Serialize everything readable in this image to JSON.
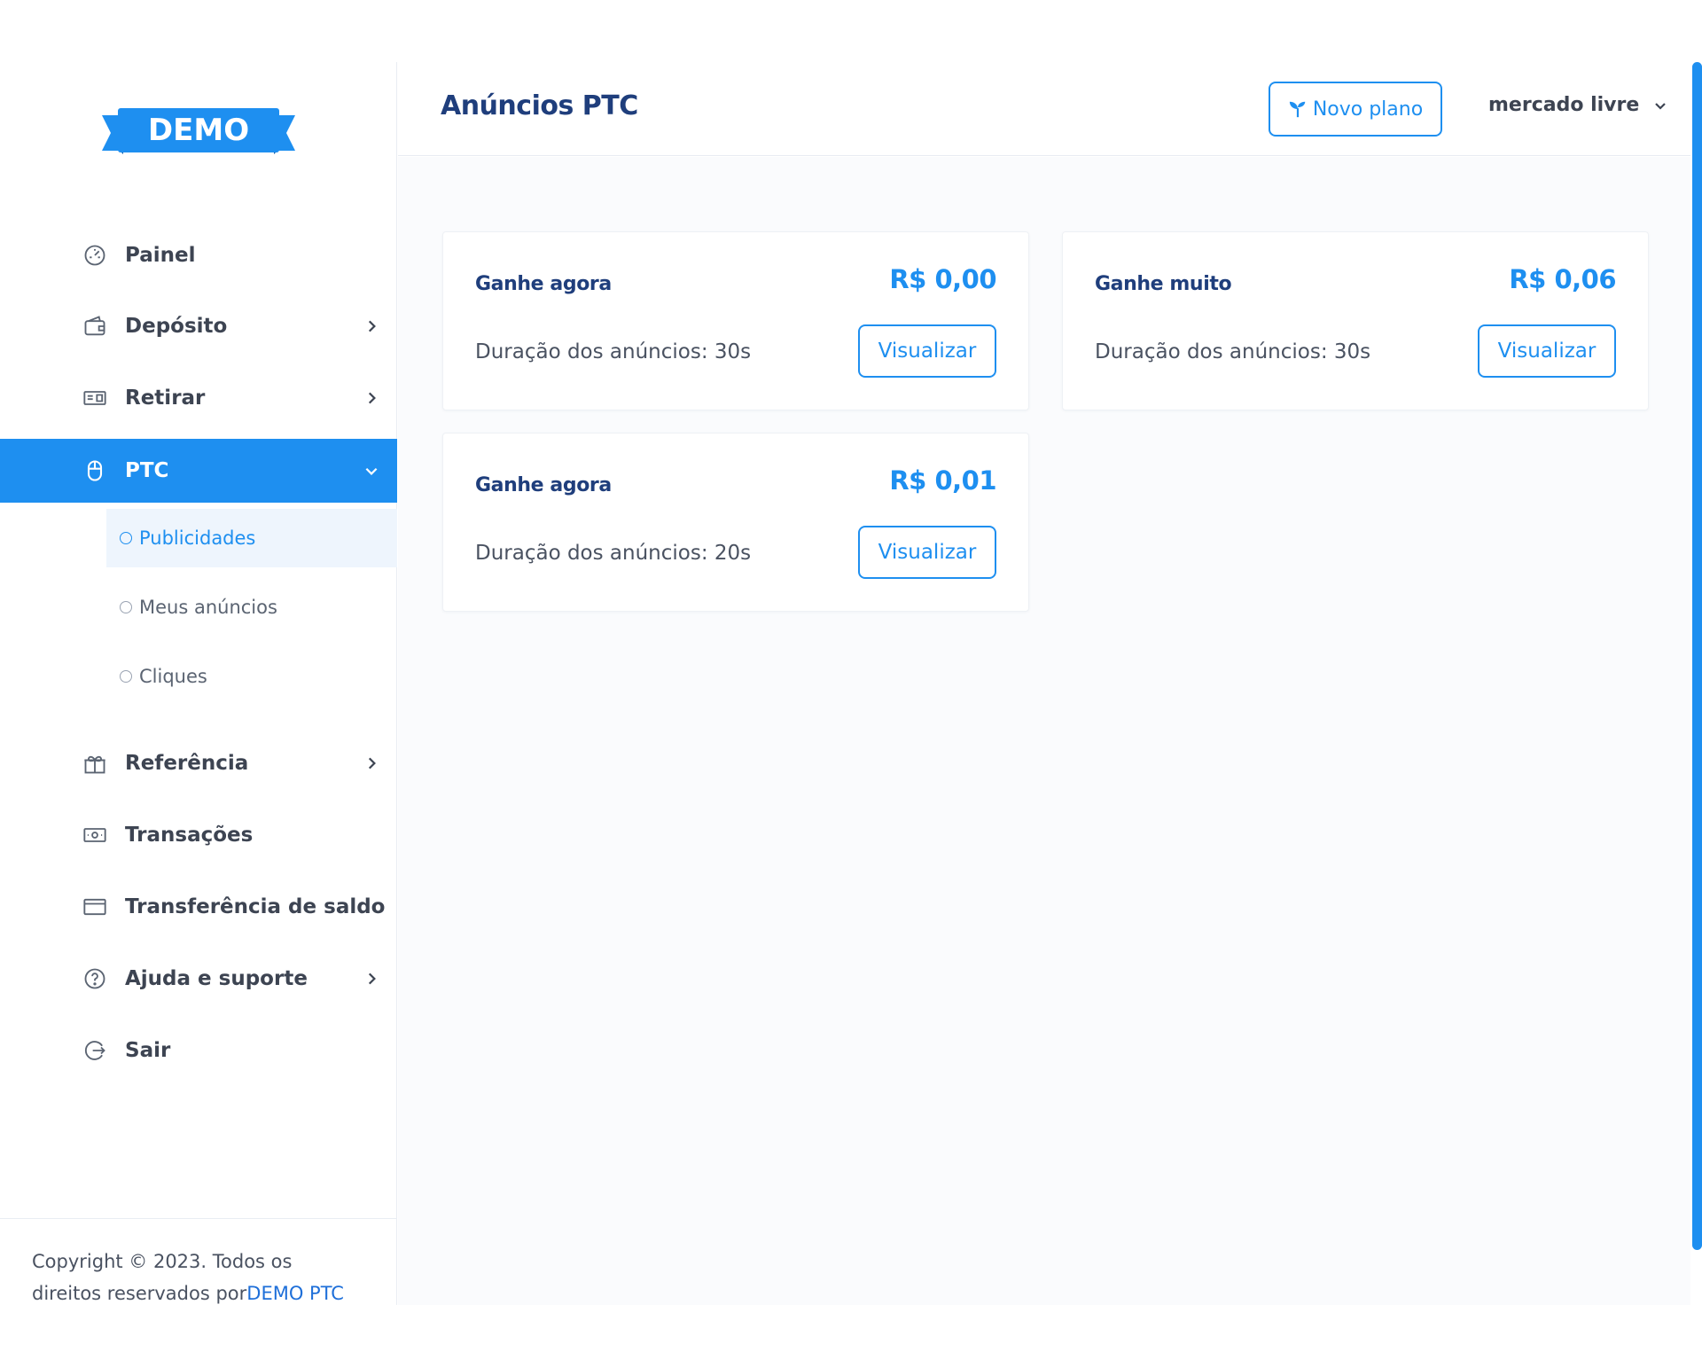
{
  "brand": {
    "logo_text": "DEMO",
    "accent": "#1e8ff0",
    "title_color": "#1f3e7c"
  },
  "sidebar": {
    "items": [
      {
        "label": "Painel",
        "icon": "gauge-icon"
      },
      {
        "label": "Depósito",
        "icon": "wallet-icon",
        "has_submenu": true
      },
      {
        "label": "Retirar",
        "icon": "cash-icon",
        "has_submenu": true
      },
      {
        "label": "PTC",
        "icon": "mouse-icon",
        "has_submenu": true,
        "active": true
      }
    ],
    "ptc_submenu": [
      {
        "label": "Publicidades",
        "current": true
      },
      {
        "label": "Meus anúncios"
      },
      {
        "label": "Cliques"
      }
    ],
    "items_after": [
      {
        "label": "Referência",
        "icon": "gift-icon",
        "has_submenu": true
      },
      {
        "label": "Transações",
        "icon": "money-icon"
      },
      {
        "label": "Transferência de saldo",
        "icon": "credit-card-icon"
      },
      {
        "label": "Ajuda e suporte",
        "icon": "help-icon",
        "has_submenu": true
      },
      {
        "label": "Sair",
        "icon": "logout-icon"
      }
    ],
    "footer": {
      "line1": "Copyright © 2023. Todos os",
      "line2_prefix": "direitos reservados por",
      "link": "DEMO PTC"
    }
  },
  "header": {
    "title": "Anúncios PTC",
    "new_plan_label": "Novo plano",
    "user_menu_label": "mercado livre"
  },
  "ads": [
    {
      "title": "Ganhe agora",
      "price": "R$ 0,00",
      "duration": "Duração dos anúncios: 30s",
      "button": "Visualizar"
    },
    {
      "title": "Ganhe muito",
      "price": "R$ 0,06",
      "duration": "Duração dos anúncios: 30s",
      "button": "Visualizar"
    },
    {
      "title": "Ganhe agora",
      "price": "R$ 0,01",
      "duration": "Duração dos anúncios: 20s",
      "button": "Visualizar"
    }
  ]
}
